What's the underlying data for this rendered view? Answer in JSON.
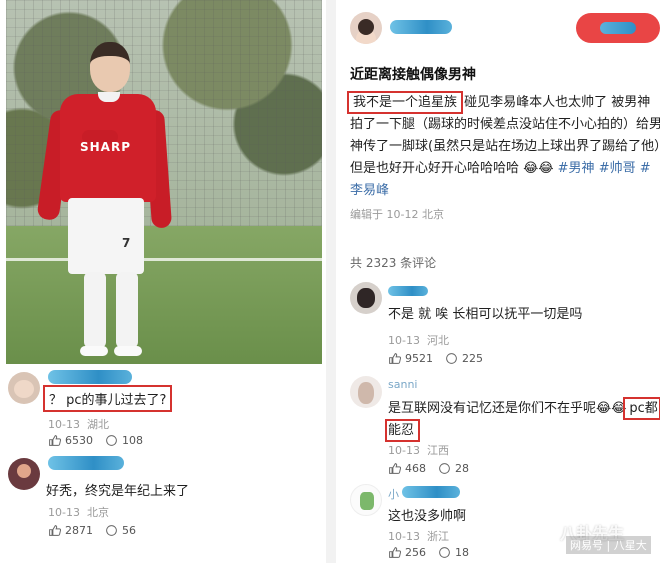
{
  "left": {
    "photo": {
      "shirt_sponsor": "SHARP",
      "shorts_number": "7"
    },
    "comments": [
      {
        "text": "？ pc的事儿过去了?",
        "date": "10-13",
        "location": "湖北",
        "likes": "6530",
        "replies": "108"
      },
      {
        "text": "好秃，终究是年纪上来了",
        "date": "10-13",
        "location": "北京",
        "likes": "2871",
        "replies": "56"
      }
    ]
  },
  "post": {
    "title": "近距离接触偶像男神",
    "highlight": "我不是一个追星族",
    "body_rest": "碰见李易峰本人也太帅了 被男神拍了一下腿（踢球的时候差点没站住不小心拍的）给男神传了一脚球(虽然只是站在场边上球出界了踢给了他）但是也好开心好开心哈哈哈哈 😂😂",
    "tags": [
      "#男神",
      "#帅哥",
      "#李易峰"
    ],
    "meta": "编辑于 10-12 北京",
    "comment_count": "共 2323 条评论"
  },
  "right_comments": [
    {
      "user": "",
      "text": "不是 就 唉 长相可以抚平一切是吗",
      "date": "10-13",
      "location": "河北",
      "likes": "9521",
      "replies": "225"
    },
    {
      "user": "sanni",
      "text_main": "是互联网没有记忆还是你们不在乎呢😂😂",
      "text_highlight": "pc都能忍",
      "date": "10-13",
      "location": "江西",
      "likes": "468",
      "replies": "28"
    },
    {
      "user": "小",
      "text": "这也没多帅啊",
      "date": "10-13",
      "location": "浙江",
      "likes": "256",
      "replies": "18"
    }
  ],
  "watermark": {
    "big": "八卦先生",
    "small": "网易号 | 八星大"
  },
  "colors": {
    "highlight_box": "#d5322f",
    "tag": "#3d6ea8",
    "follow_button": "#e94545",
    "redaction": "#2f8fc6"
  }
}
